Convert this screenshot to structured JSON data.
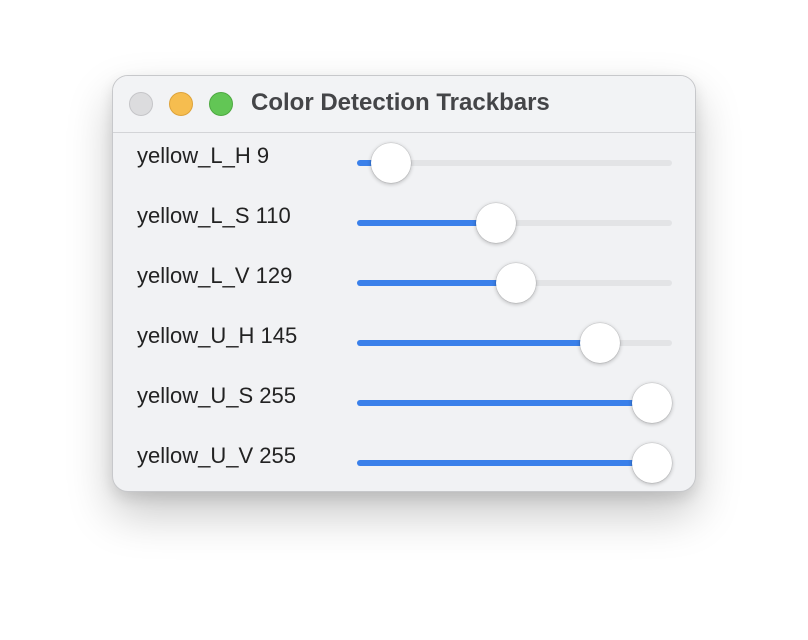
{
  "window": {
    "title": "Color Detection Trackbars"
  },
  "trackbars": [
    {
      "label": "yellow_L_H 9",
      "value": 9,
      "max": 179
    },
    {
      "label": "yellow_L_S 110",
      "value": 110,
      "max": 255
    },
    {
      "label": "yellow_L_V 129",
      "value": 129,
      "max": 255
    },
    {
      "label": "yellow_U_H 145",
      "value": 145,
      "max": 179
    },
    {
      "label": "yellow_U_S 255",
      "value": 255,
      "max": 255
    },
    {
      "label": "yellow_U_V 255",
      "value": 255,
      "max": 255
    }
  ],
  "colors": {
    "accent": "#3a80ea",
    "track": "#e3e4e6",
    "close": "#dcdcde",
    "minimize": "#f6bd4f",
    "zoom": "#62c655"
  }
}
